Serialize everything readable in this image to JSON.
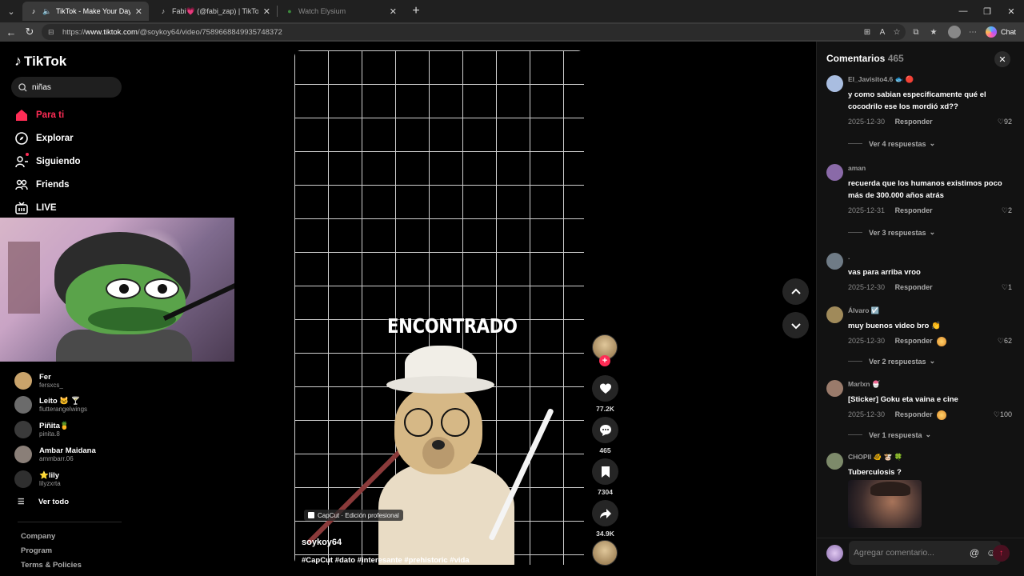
{
  "browser": {
    "tabs": [
      {
        "title": "TikTok - Make Your Day",
        "active": true
      },
      {
        "title": "Fabi💗 (@fabi_zap) | TikTok",
        "active": false
      },
      {
        "title": "Watch Elysium",
        "active": false
      }
    ],
    "url_prefix": "https://",
    "url_host": "www.tiktok.com",
    "url_path": "/@soykoy64/video/7589668849935748372",
    "chat_label": "Chat"
  },
  "sidebar": {
    "logo": "TikTok",
    "search_value": "niñas",
    "nav": [
      {
        "label": "Para ti",
        "icon": "home-icon",
        "active": true
      },
      {
        "label": "Explorar",
        "icon": "compass-icon",
        "active": false
      },
      {
        "label": "Siguiendo",
        "icon": "following-icon",
        "active": false
      },
      {
        "label": "Friends",
        "icon": "friends-icon",
        "active": false
      },
      {
        "label": "LIVE",
        "icon": "live-icon",
        "active": false
      }
    ],
    "following": [
      {
        "name": "Fer",
        "handle": "fersxcs_",
        "color": "#c9a36b"
      },
      {
        "name": "Leito 🐱 🍸",
        "handle": "flutterangelwings",
        "color": "#6b6b6b"
      },
      {
        "name": "Piñita🍍",
        "handle": "pinita.8",
        "color": "#3a3a3a"
      },
      {
        "name": "Ambar Maidana",
        "handle": "ammbarr.06",
        "color": "#8a7f78"
      },
      {
        "name": "⭐lily",
        "handle": "lilyzxrta",
        "color": "#2f2f2f"
      }
    ],
    "see_all": "Ver todo",
    "footer": [
      "Company",
      "Program",
      "Terms & Policies"
    ]
  },
  "video": {
    "overlay_text": "ENCONTRADO",
    "capcut_label": "CapCut · Edición profesional",
    "author": "soykoy64",
    "tags": "#CapCut #dato #interesante #prehistoric #vida",
    "progress": 0.36
  },
  "actions": {
    "likes": "77.2K",
    "comments": "465",
    "saves": "7304",
    "shares": "34.9K"
  },
  "comments": {
    "title": "Comentarios",
    "count": "465",
    "items": [
      {
        "user": "El_Javisito4.6 🐟 🔴",
        "text": "y como sabian especificamente qué el cocodrilo ese los mordió xd??",
        "date": "2025-12-30",
        "reply": "Responder",
        "likes": "92",
        "more": "Ver 4 respuestas",
        "color": "#a9bde0"
      },
      {
        "user": "aman",
        "text": "recuerda que los humanos existimos poco más de 300.000 años atrás",
        "date": "2025-12-31",
        "reply": "Responder",
        "likes": "2",
        "more": "Ver 3 respuestas",
        "color": "#8a6aa8"
      },
      {
        "user": ".",
        "text": "vas para arriba vroo",
        "date": "2025-12-30",
        "reply": "Responder",
        "likes": "1",
        "more": "",
        "color": "#6f7b86"
      },
      {
        "user": "Álvaro ☑️",
        "text": "muy buenos video bro 👏",
        "date": "2025-12-30",
        "reply": "Responder",
        "likes": "62",
        "more": "Ver 2 respuestas",
        "color": "#a08a5a"
      },
      {
        "user": "Marlxn 🍧",
        "text": "[Sticker] Goku eta vaina e cine",
        "date": "2025-12-30",
        "reply": "Responder",
        "likes": "100",
        "more": "Ver 1 respuesta",
        "color": "#9a7b6b"
      },
      {
        "user": "CHOPII 🐠 🐮 🍀",
        "text": "Tuberculosis ?",
        "color": "#7d8a6a"
      }
    ],
    "input_placeholder": "Agregar comentario..."
  }
}
